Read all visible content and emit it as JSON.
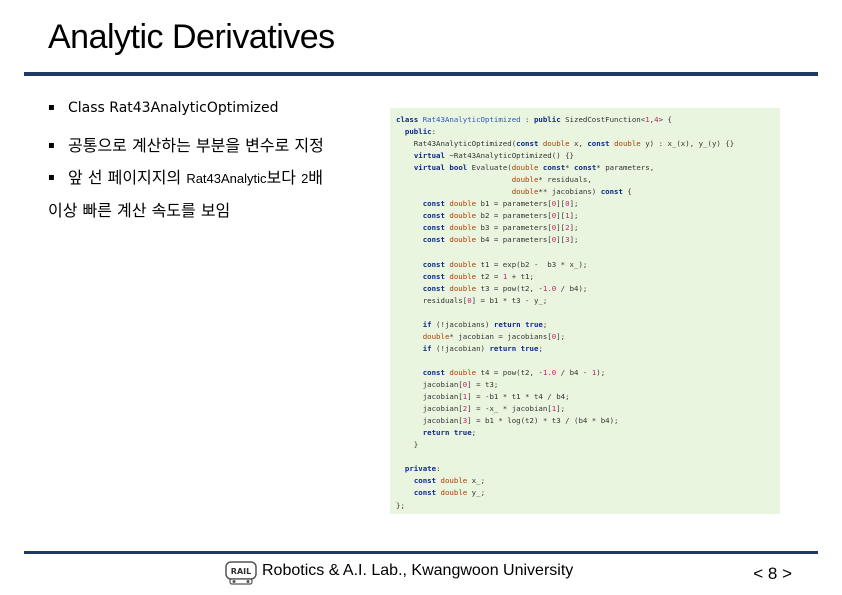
{
  "slide": {
    "title": "Analytic Derivatives",
    "bullets": [
      {
        "text": "Class Rat43AnalyticOptimized"
      },
      {
        "text": "공통으로 계산하는 부분을 변수로 지정"
      },
      {
        "text_a": "앞 선 페이지지의 ",
        "text_b": "Rat43Analytic",
        "text_c": "보다 ",
        "text_d": "2",
        "text_e": "배",
        "continuation": "이상 빠른 계산 속도를 보임"
      }
    ],
    "bullet_mark": "▪"
  },
  "code": {
    "lines": [
      "class Rat43AnalyticOptimized : public SizedCostFunction<1,4> {",
      "  public:",
      "    Rat43AnalyticOptimized(const double x, const double y) : x_(x), y_(y) {}",
      "    virtual ~Rat43AnalyticOptimized() {}",
      "    virtual bool Evaluate(double const* const* parameters,",
      "                          double* residuals,",
      "                          double** jacobians) const {",
      "      const double b1 = parameters[0][0];",
      "      const double b2 = parameters[0][1];",
      "      const double b3 = parameters[0][2];",
      "      const double b4 = parameters[0][3];",
      "",
      "      const double t1 = exp(b2 -  b3 * x_);",
      "      const double t2 = 1 + t1;",
      "      const double t3 = pow(t2, -1.0 / b4);",
      "      residuals[0] = b1 * t3 - y_;",
      "",
      "      if (!jacobians) return true;",
      "      double* jacobian = jacobians[0];",
      "      if (!jacobian) return true;",
      "",
      "      const double t4 = pow(t2, -1.0 / b4 - 1);",
      "      jacobian[0] = t3;",
      "      jacobian[1] = -b1 * t1 * t4 / b4;",
      "      jacobian[2] = -x_ * jacobian[1];",
      "      jacobian[3] = b1 * log(t2) * t3 / (b4 * b4);",
      "      return true;",
      "    }",
      "",
      "  private:",
      "    const double x_;",
      "    const double y_;",
      "};"
    ]
  },
  "footer": {
    "logo_text": "RAIL",
    "org": "Robotics & A.I. Lab., Kwangwoon University",
    "page": "< 8 >"
  },
  "colors": {
    "rule": "#1f3864",
    "code_bg": "#eaf5df"
  }
}
